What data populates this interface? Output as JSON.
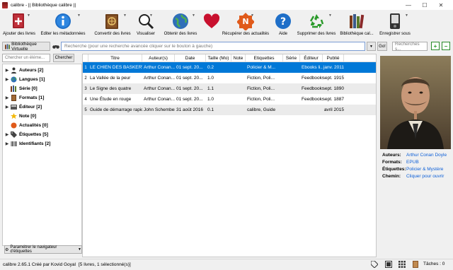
{
  "window": {
    "title": "calibre - || Bibliothèque calibre ||",
    "minimize": "—",
    "maximize": "☐",
    "close": "✕"
  },
  "toolbar": {
    "add_books": "Ajouter des livres",
    "edit_metadata": "Editer les métadonnées",
    "convert": "Convertir des livres",
    "view": "Visualiser",
    "get_books": "Obtenir des livres",
    "fetch_news": "Récupérer des actualités",
    "help": "Aide",
    "remove_books": "Supprimer des livres",
    "library": "Bibliothèque cal...",
    "save": "Enregistrer sous"
  },
  "searchbar": {
    "virtual_library": "Bibliothèque Virtuelle",
    "placeholder": "Recherche (pour une recherche avancée cliquer sur le bouton à gauche)",
    "go": "Go!",
    "saved_search_placeholder": "Recherches s..."
  },
  "tag_browser": {
    "search_placeholder": "Chercher un éléme...",
    "find_button": "Chercher",
    "configure_button": "Paramétrer le navigateur d'étiquettes",
    "items": [
      {
        "label": "Auteurs [2]",
        "icon": "user-icon"
      },
      {
        "label": "Langues [1]",
        "icon": "globe-icon"
      },
      {
        "label": "Série [0]",
        "icon": "series-icon"
      },
      {
        "label": "Formats [1]",
        "icon": "book-icon"
      },
      {
        "label": "Éditeur [2]",
        "icon": "publisher-icon"
      },
      {
        "label": "Note [0]",
        "icon": "star-icon"
      },
      {
        "label": "Actualités [0]",
        "icon": "news-icon"
      },
      {
        "label": "Étiquettes [5]",
        "icon": "tag-icon"
      },
      {
        "label": "Identifiants [2]",
        "icon": "barcode-icon"
      }
    ]
  },
  "book_table": {
    "columns": [
      "Titre",
      "Auteur(s)",
      "Date",
      "Taille (Mo)",
      "Note",
      "Etiquettes",
      "Série",
      "Éditeur",
      "Publié"
    ],
    "rows": [
      {
        "num": "1",
        "title": "LE CHIEN DES BASKERVIL...",
        "author": "Arthur Conan...",
        "date": "01 sept. 20...",
        "size": "0.2",
        "rating": "",
        "tags": "Policier & M...",
        "series": "",
        "publisher": "Ebooks li...",
        "published": "janv. 2011"
      },
      {
        "num": "2",
        "title": "La Vallée de la peur",
        "author": "Arthur Conan...",
        "date": "01 sept. 20...",
        "size": "1.0",
        "rating": "",
        "tags": "Fiction, Poli...",
        "series": "",
        "publisher": "Feedbooks",
        "published": "sept. 1915"
      },
      {
        "num": "3",
        "title": "Le Signe des quatre",
        "author": "Arthur Conan...",
        "date": "01 sept. 20...",
        "size": "1.1",
        "rating": "",
        "tags": "Fiction, Poli...",
        "series": "",
        "publisher": "Feedbooks",
        "published": "sept. 1890"
      },
      {
        "num": "4",
        "title": "Une Étude en rouge",
        "author": "Arthur Conan...",
        "date": "01 sept. 20...",
        "size": "1.0",
        "rating": "",
        "tags": "Fiction, Poli...",
        "series": "",
        "publisher": "Feedbooks",
        "published": "sept. 1887"
      },
      {
        "num": "5",
        "title": "Guide de démarrage rapide",
        "author": "John Schember",
        "date": "31 août 2016",
        "size": "0.1",
        "rating": "",
        "tags": "calibre, Guide",
        "series": "",
        "publisher": "",
        "published": "avril 2015"
      }
    ]
  },
  "book_details": {
    "authors_label": "Auteurs:",
    "authors_value": "Arthur Conan Doyle",
    "formats_label": "Formats:",
    "formats_value": "EPUB",
    "tags_label": "Étiquettes:",
    "tags_value": "Policier & Mystère",
    "path_label": "Chemin:",
    "path_value": "Cliquer pour ouvrir"
  },
  "statusbar": {
    "version": "calibre 2.65.1 Créé par Kovid Goyal",
    "count": "[5 livres, 1 sélectionné(s)]",
    "jobs": "Tâches : 0"
  },
  "colors": {
    "selection": "#0078d7",
    "link": "#0b5ed7",
    "accent_green": "#1e9a1e"
  }
}
